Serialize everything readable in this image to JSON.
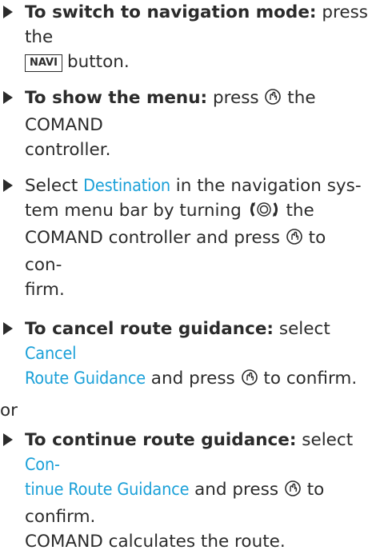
{
  "items": [
    {
      "bold": "To switch to navigation mode:",
      "text1": " press the",
      "key": "NAVI",
      "text2": "button."
    },
    {
      "bold": "To show the menu:",
      "text1": " press ",
      "text2": " the COMAND",
      "text3": "controller."
    },
    {
      "text1": "Select ",
      "hl": "Destination",
      "text2": " in the navigation sys-",
      "text3": "tem menu bar by turning ",
      "text4": " the",
      "text5": "COMAND controller and press ",
      "text6": " to con-",
      "text7": "firm."
    },
    {
      "bold": "To cancel route guidance:",
      "text1": " select ",
      "hl1": "Cancel",
      "hl2": "Route Guidance",
      "text2": " and press ",
      "text3": " to confirm."
    },
    {
      "or": "or"
    },
    {
      "bold": "To continue route guidance:",
      "text1": " select ",
      "hl1": "Con-",
      "hl2": "tinue Route Guidance",
      "text2": " and press ",
      "text3": " to",
      "text4": "confirm.",
      "text5": "COMAND calculates the route."
    }
  ],
  "icons": {
    "press": "press-controller-icon",
    "turn": "turn-controller-icon"
  }
}
